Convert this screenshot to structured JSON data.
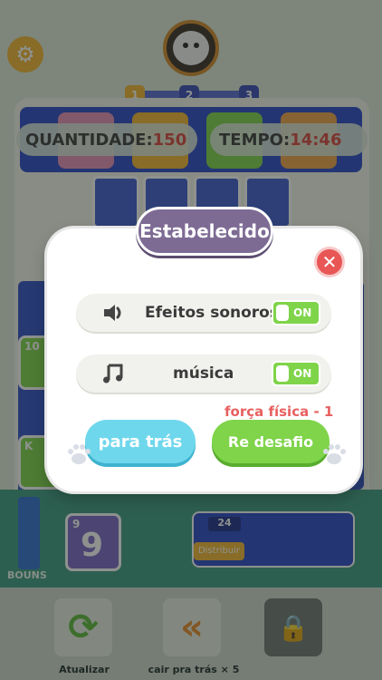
{
  "game": {
    "levels": [
      "1",
      "2",
      "3"
    ],
    "quantity_label": "QUANTIDADE:",
    "quantity_value": "150",
    "time_label": "TEMPO:",
    "time_value": "14:46",
    "side_card_top": "10",
    "side_card_bottom": "K",
    "bonus_label": "BOUNS",
    "hand_card": {
      "corner": "9",
      "value": "9"
    },
    "deck_count": "24",
    "deck_action": "Distribuir",
    "tools": [
      {
        "label": "Atualizar",
        "icon": "refresh-icon"
      },
      {
        "label": "cair pra trás × 5",
        "icon": "undo-icon"
      },
      {
        "label": "",
        "icon": "lock-icon"
      }
    ]
  },
  "dialog": {
    "title": "Estabelecido",
    "sound_label": "Efeitos sonoros",
    "sound_state": "ON",
    "music_label": "música",
    "music_state": "ON",
    "strength_text": "força física - 1",
    "back_button": "para trás",
    "retry_button": "Re desafio"
  },
  "colors": {
    "title_bg": "#7d6b94",
    "toggle_on": "#7fd44a",
    "back_btn": "#6fd7ec",
    "retry_btn": "#7fd44a",
    "close_btn": "#e85656",
    "strength_text": "#e86060"
  }
}
